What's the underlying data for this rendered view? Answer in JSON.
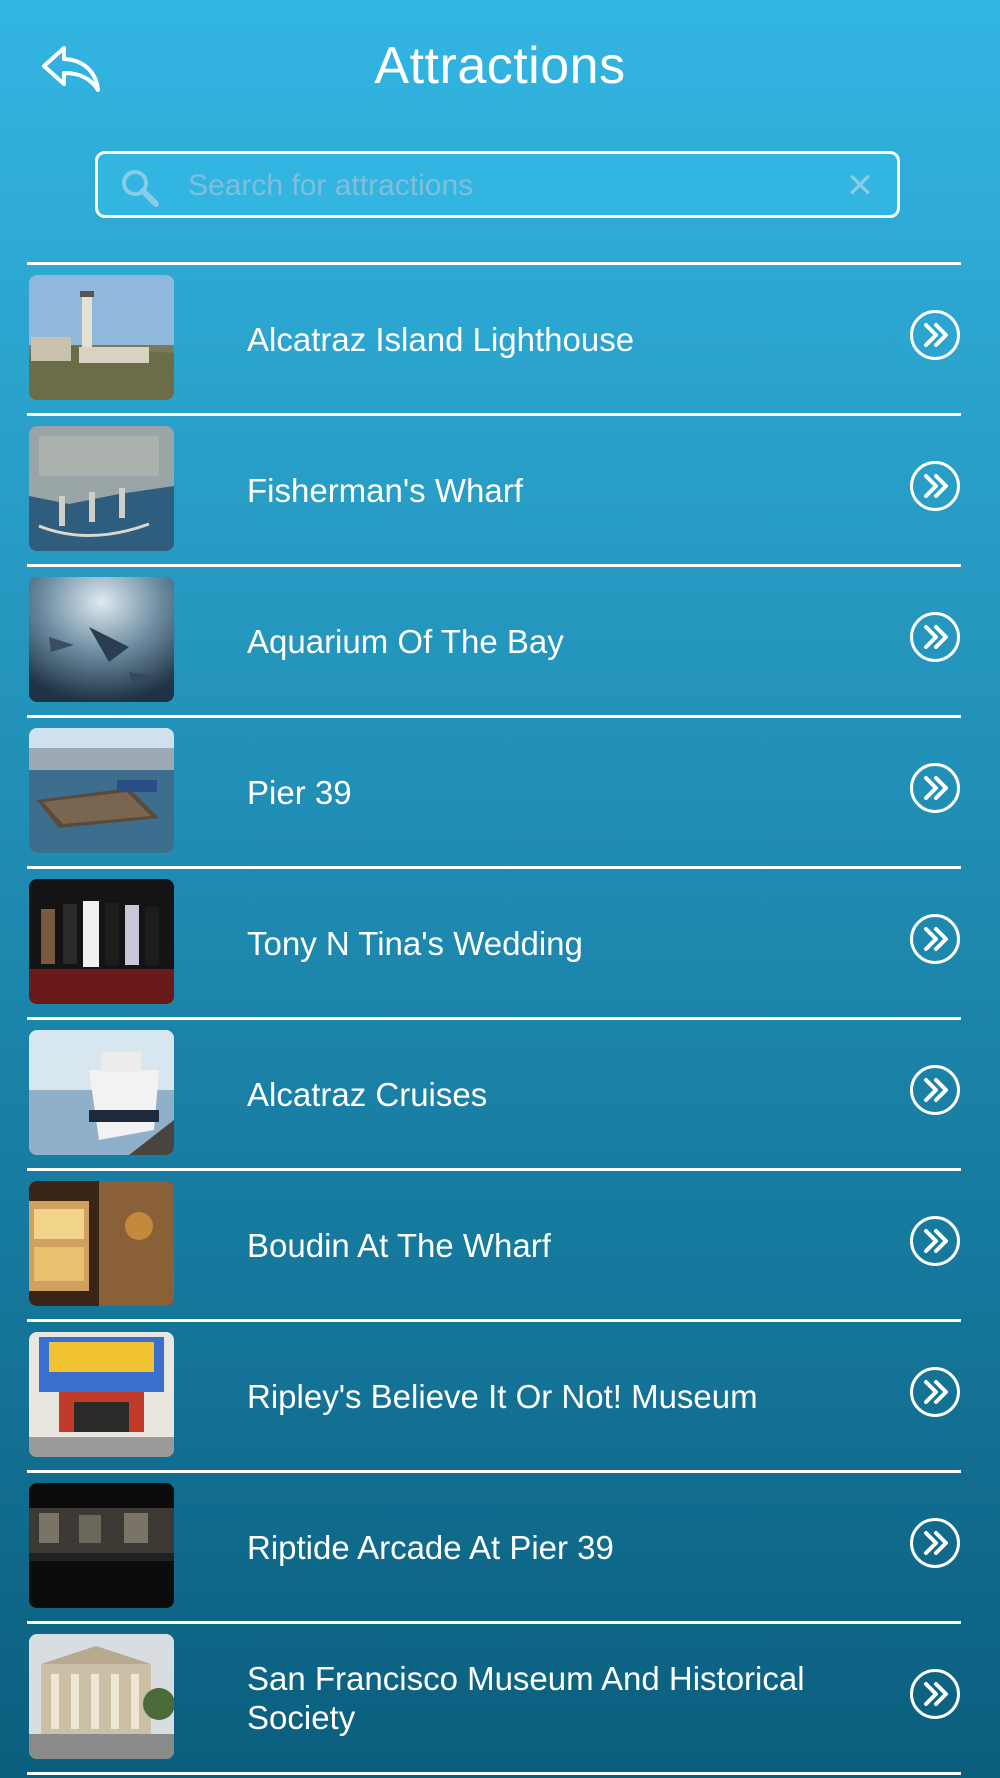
{
  "header": {
    "title": "Attractions",
    "back_icon": "reply-arrow-icon"
  },
  "search": {
    "placeholder": "Search for attractions",
    "value": "",
    "search_icon": "magnifier-icon",
    "clear_icon": "close-icon",
    "clear_glyph": "✕"
  },
  "colors": {
    "background_top": "#33b5e2",
    "background_bottom": "#0b5e7d",
    "text": "#ffffff",
    "placeholder": "#7fbfdc"
  },
  "attractions": [
    {
      "name": "Alcatraz Island Lighthouse",
      "thumb": "lighthouse-photo"
    },
    {
      "name": "Fisherman's Wharf",
      "thumb": "aerial-wharf-photo"
    },
    {
      "name": "Aquarium Of The Bay",
      "thumb": "aquarium-tunnel-photo"
    },
    {
      "name": "Pier 39",
      "thumb": "sea-lions-pier-photo"
    },
    {
      "name": "Tony N Tina's Wedding",
      "thumb": "wedding-cast-photo"
    },
    {
      "name": "Alcatraz Cruises",
      "thumb": "ferry-boat-photo"
    },
    {
      "name": "Boudin At The Wharf",
      "thumb": "bakery-storefront-photo"
    },
    {
      "name": "Ripley's Believe It Or Not! Museum",
      "thumb": "museum-entrance-photo"
    },
    {
      "name": "Riptide Arcade At Pier 39",
      "thumb": "arcade-interior-photo"
    },
    {
      "name": "San Francisco Museum And Historical Society",
      "thumb": "historic-building-photo"
    }
  ],
  "row_arrow_icon": "double-chevron-right-circle-icon"
}
